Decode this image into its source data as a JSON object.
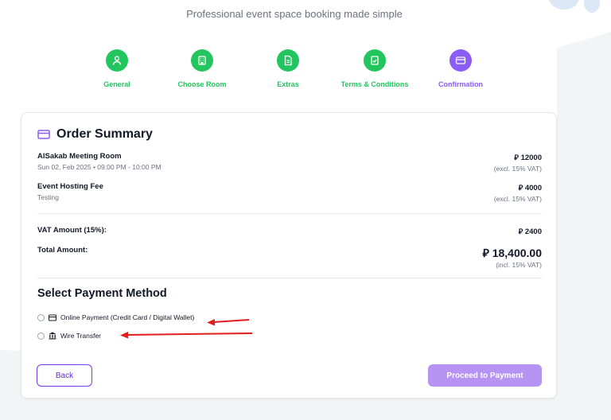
{
  "header": {
    "subtitle": "Professional event space booking made simple"
  },
  "steps": [
    {
      "label": "General",
      "icon": "user-icon",
      "color": "#22c55e"
    },
    {
      "label": "Choose Room",
      "icon": "building-icon",
      "color": "#22c55e"
    },
    {
      "label": "Extras",
      "icon": "document-icon",
      "color": "#22c55e"
    },
    {
      "label": "Terms & Conditions",
      "icon": "checklist-icon",
      "color": "#22c55e"
    },
    {
      "label": "Confirmation",
      "icon": "card-icon",
      "color": "#8b5cf6"
    }
  ],
  "summary": {
    "title": "Order Summary",
    "items": [
      {
        "name": "AlSakab Meeting Room",
        "detail": "Sun 02, Feb 2025  •  09:00 PM - 10:00 PM",
        "price": "⃁ 12000",
        "vat_note": "(excl. 15% VAT)"
      },
      {
        "name": "Event Hosting Fee",
        "detail": "Testing",
        "price": "⃁ 4000",
        "vat_note": "(excl. 15% VAT)"
      }
    ],
    "vat_label": "VAT Amount (15%):",
    "vat_value": "⃁ 2400",
    "total_label": "Total Amount:",
    "total_value": "⃁ 18,400.00",
    "total_note": "(incl. 15% VAT)"
  },
  "payment": {
    "title": "Select Payment Method",
    "options": [
      {
        "label": "Online Payment (Credit Card / Digital Wallet)",
        "icon": "credit-card-icon"
      },
      {
        "label": "Wire Transfer",
        "icon": "bank-icon"
      }
    ]
  },
  "buttons": {
    "back": "Back",
    "proceed": "Proceed to Payment"
  },
  "colors": {
    "accent": "#8b5cf6",
    "success": "#22c55e",
    "annotation": "#e11d1d"
  }
}
